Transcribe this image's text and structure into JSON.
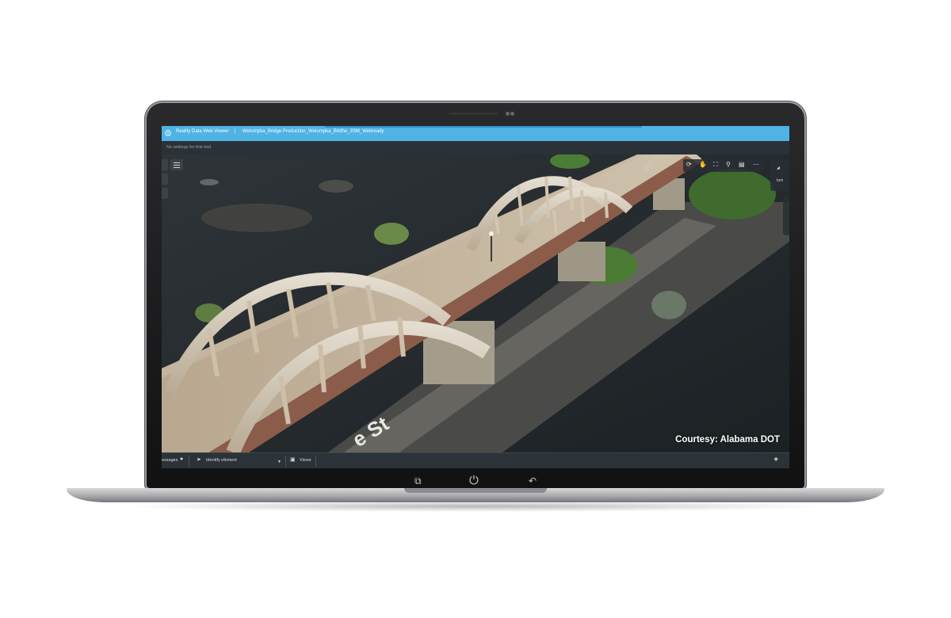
{
  "app": {
    "title": "Reality Data Web Viewer",
    "separator": "|",
    "project": "Wetumpka_Bridge Production_Wetumpka_Bridhe_3SM_Webready",
    "settings_message": "No settings for this tool."
  },
  "viewport": {
    "courtesy": "Courtesy: Alabama DOT",
    "street_label": "e St"
  },
  "toolbar": {
    "icons": [
      "rotate-icon",
      "pan-hand-icon",
      "fit-view-icon",
      "zoom-icon",
      "calendar-icon",
      "more-icon"
    ]
  },
  "right_panel": {
    "label": "tum"
  },
  "statusbar": {
    "messages_label": "essages",
    "identify_label": "Identify element",
    "views_label": "Views"
  },
  "colors": {
    "titlebar": "#4fb3e4",
    "panel": "#2c3338",
    "water": "#24292c"
  }
}
